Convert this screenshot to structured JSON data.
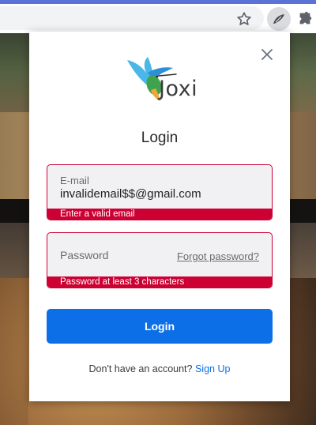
{
  "browser": {
    "star_icon": "star-icon",
    "extension_icon": "joxi-extension-icon",
    "extensions_icon": "puzzle-icon",
    "accent_color": "#5b73d6"
  },
  "popup": {
    "logo_text": "Joxi",
    "title": "Login",
    "email": {
      "label": "E-mail",
      "value": "invalidemail$$@gmail.com",
      "error": "Enter a valid email"
    },
    "password": {
      "placeholder": "Password",
      "forgot_link": "Forgot password?",
      "error": "Password at least 3 characters"
    },
    "login_button": "Login",
    "signup_prompt": "Don't have an account?",
    "signup_link": "Sign Up",
    "colors": {
      "primary": "#0d6fe8",
      "error": "#cc0033"
    }
  }
}
